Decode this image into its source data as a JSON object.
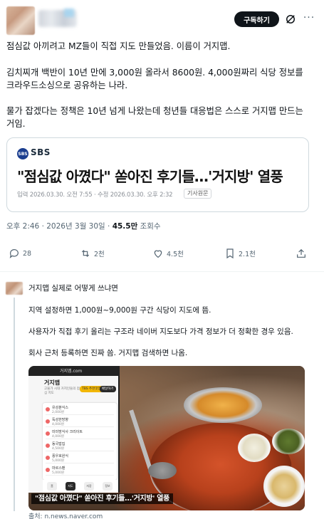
{
  "post": {
    "subscribe_label": "구독하기",
    "paragraph1": "점심값 아끼려고 MZ들이 직접 지도 만들었음. 이름이 거지맵.",
    "paragraph2_line1": "김치찌개 백반이 10년 만에 3,000원 올라서 8600원. 4,000원짜리 식당 정보를",
    "paragraph2_line2": "크라우드소싱으로 공유하는 나라.",
    "paragraph3_line1": "물가 잡겠다는 정책은 10년 넘게 나왔는데 청년들 대응법은 스스로 거지맵 만드는",
    "paragraph3_line2": "거임."
  },
  "link_card": {
    "source_logo": "SBS",
    "source_name": "SBS",
    "headline": "\"점심값 아꼈다\" 쏟아진 후기들…'거지방' 열풍",
    "meta": "입력 2026.03.30. 오전 7:55 · 수정 2026.03.30. 오후 2:32",
    "badge": "기사원문"
  },
  "meta": {
    "time_date": "오후 2:46 · 2026년 3월 30일 · ",
    "views": "45.5만",
    "views_label": " 조회수"
  },
  "actions": {
    "replies": "28",
    "reposts": "2천",
    "likes": "4.5천",
    "bookmarks": "2.1천"
  },
  "reply": {
    "line1": "거지맵 실제로 어떻게 쓰냐면",
    "line2": "지역 설정하면 1,000원~9,000원 구간 식당이 지도에 뜸.",
    "line3": "사용자가 직접 후기 올리는 구조라 네이버 지도보다 가격 정보가 더 정확한 경우 있음.",
    "line4": "회사 근처 등록하면 진짜 씀. 거지맵 검색하면 나옴.",
    "media_caption": "\"점심값 아꼈다\" 쏟아진 후기들…'거지방' 열풍",
    "phone": {
      "status": "거지맵.com",
      "title": "거지맵",
      "subtitle": "고물가 시대 거지인들의 점심 지도",
      "chip1": "TBS 추천맛집",
      "chip2": "배달하기",
      "items": [
        {
          "name": "유성분식스",
          "price": "2,000원"
        },
        {
          "name": "독성한방향",
          "price": "4,000원"
        },
        {
          "name": "미미방식사 크리이트",
          "price": "4,000원"
        },
        {
          "name": "동국밥집",
          "price": "4,500원"
        },
        {
          "name": "풍우호원식",
          "price": "5,000원"
        },
        {
          "name": "마르스팬",
          "price": "5,000원"
        }
      ],
      "nav": [
        "홈",
        "지도",
        "저장",
        "정보"
      ]
    },
    "source": "출처: n.news.naver.com"
  },
  "colors": {
    "text": "#0f1419",
    "secondary": "#536471",
    "border": "#cfd9de",
    "button_bg": "#0f1419"
  }
}
